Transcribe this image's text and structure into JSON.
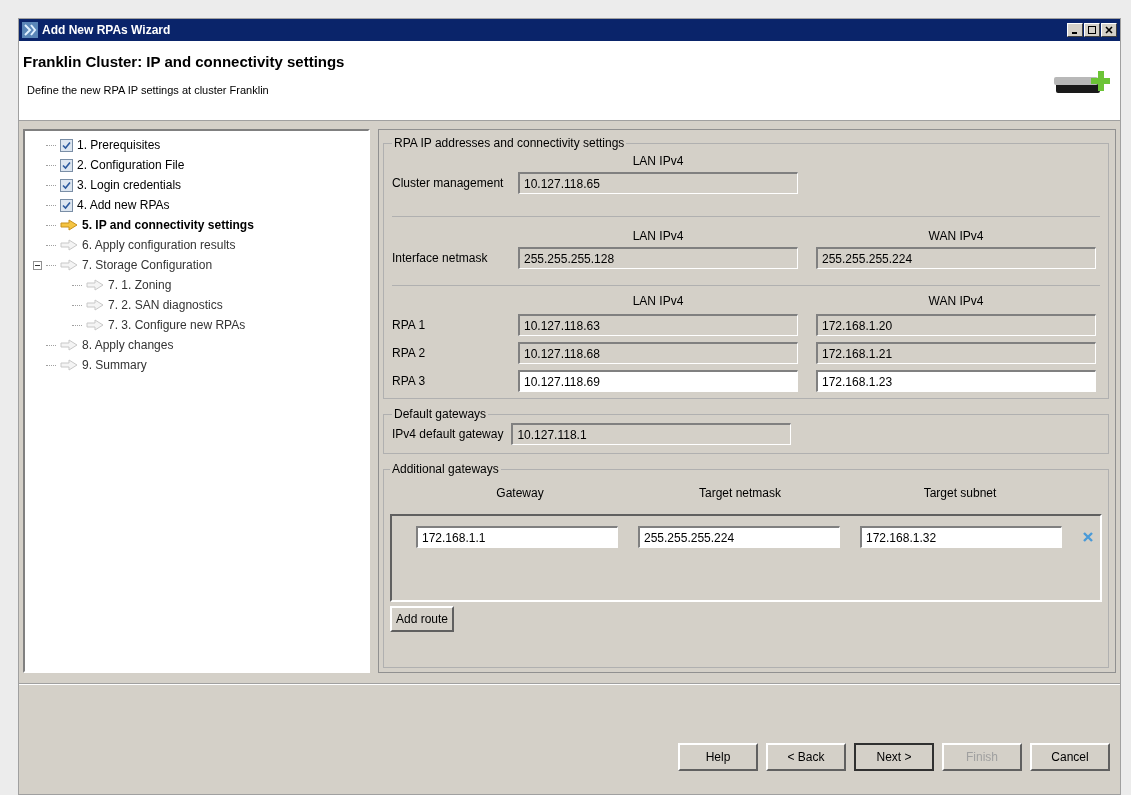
{
  "window": {
    "title": "Add New RPAs Wizard"
  },
  "header": {
    "title": "Franklin Cluster: IP and connectivity settings",
    "subtitle": "Define the new RPA IP settings at cluster Franklin"
  },
  "steps": [
    {
      "label": "1. Prerequisites",
      "kind": "done"
    },
    {
      "label": "2. Configuration File",
      "kind": "done"
    },
    {
      "label": "3. Login credentials",
      "kind": "done"
    },
    {
      "label": "4. Add new RPAs",
      "kind": "done"
    },
    {
      "label": "5. IP and connectivity settings",
      "kind": "current"
    },
    {
      "label": "6. Apply configuration results",
      "kind": "pending"
    },
    {
      "label": "7. Storage Configuration",
      "kind": "pending",
      "expanded": true,
      "children": [
        {
          "label": "7. 1. Zoning",
          "kind": "pending"
        },
        {
          "label": "7. 2. SAN diagnostics",
          "kind": "pending"
        },
        {
          "label": "7. 3. Configure new RPAs",
          "kind": "pending"
        }
      ]
    },
    {
      "label": "8. Apply changes",
      "kind": "pending"
    },
    {
      "label": "9. Summary",
      "kind": "pending"
    }
  ],
  "addresses": {
    "legend": "RPA IP addresses and connectivity settings",
    "cluster_management": {
      "label": "Cluster management",
      "lan_header": "LAN IPv4",
      "lan": {
        "value": "10.127.118.65",
        "disabled": true
      }
    },
    "netmask": {
      "label": "Interface netmask",
      "lan_header": "LAN IPv4",
      "wan_header": "WAN IPv4",
      "lan": {
        "value": "255.255.255.128",
        "disabled": true
      },
      "wan": {
        "value": "255.255.255.224",
        "disabled": true
      }
    },
    "rpas": {
      "lan_header": "LAN IPv4",
      "wan_header": "WAN IPv4",
      "rows": [
        {
          "label": "RPA 1",
          "lan": {
            "value": "10.127.118.63",
            "disabled": true
          },
          "wan": {
            "value": "172.168.1.20",
            "disabled": true
          }
        },
        {
          "label": "RPA 2",
          "lan": {
            "value": "10.127.118.68",
            "disabled": true
          },
          "wan": {
            "value": "172.168.1.21",
            "disabled": true
          }
        },
        {
          "label": "RPA 3",
          "lan": {
            "value": "10.127.118.69",
            "disabled": false
          },
          "wan": {
            "value": "172.168.1.23",
            "disabled": false
          }
        }
      ]
    }
  },
  "default_gateways": {
    "legend": "Default gateways",
    "label": "IPv4 default gateway",
    "field": {
      "value": "10.127.118.1",
      "disabled": true
    }
  },
  "additional_gateways": {
    "legend": "Additional gateways",
    "columns": [
      "Gateway",
      "Target netmask",
      "Target subnet"
    ],
    "rows": [
      {
        "gateway": "172.168.1.1",
        "netmask": "255.255.255.224",
        "subnet": "172.168.1.32"
      }
    ],
    "add_button": "Add route"
  },
  "buttons": [
    {
      "label": "Help",
      "disabled": false,
      "default": false
    },
    {
      "label": "< Back",
      "disabled": false,
      "default": false
    },
    {
      "label": "Next >",
      "disabled": false,
      "default": true
    },
    {
      "label": "Finish",
      "disabled": true,
      "default": false
    },
    {
      "label": "Cancel",
      "disabled": false,
      "default": false
    }
  ]
}
